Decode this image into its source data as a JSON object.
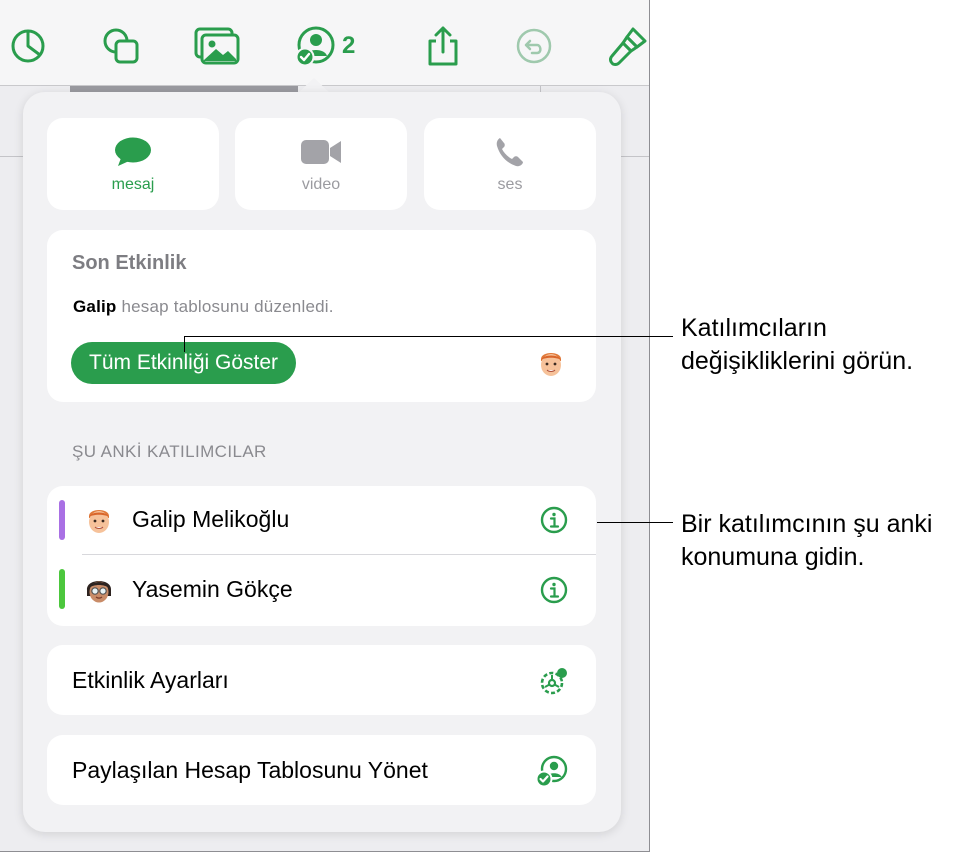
{
  "toolbar": {
    "items": [
      {
        "name": "chart-icon"
      },
      {
        "name": "shapes-icon"
      },
      {
        "name": "media-icon"
      },
      {
        "name": "collaborate-icon",
        "count": "2"
      },
      {
        "name": "share-icon"
      },
      {
        "name": "undo-icon"
      },
      {
        "name": "format-brush-icon"
      }
    ]
  },
  "popover": {
    "share_options": [
      {
        "label": "mesaj",
        "icon": "message-bubble-icon",
        "active": true
      },
      {
        "label": "video",
        "icon": "video-camera-icon",
        "active": false
      },
      {
        "label": "ses",
        "icon": "phone-icon",
        "active": false
      }
    ],
    "recent_activity": {
      "title": "Son Etkinlik",
      "user": "Galip",
      "action": "hesap tablosunu düzenledi.",
      "button_label": "Tüm Etkinliği Göster"
    },
    "participants_header": "ŞU ANKİ KATILIMCILAR",
    "participants": [
      {
        "name": "Galip Melikoğlu",
        "color": "#a970e4",
        "avatar": "memoji-red-hair"
      },
      {
        "name": "Yasemin Gökçe",
        "color": "#4cc73d",
        "avatar": "memoji-dark-hair-glasses"
      }
    ],
    "activity_settings_label": "Etkinlik Ayarları",
    "manage_label": "Paylaşılan Hesap Tablosunu Yönet"
  },
  "callouts": {
    "activity": [
      "Katılımcıların",
      "değişikliklerini görün."
    ],
    "participant": [
      "Bir katılımcının şu anki",
      "konumuna gidin."
    ]
  },
  "colors": {
    "accent": "#2a9d4d",
    "secondary_text": "#8a8a8f",
    "popover_bg": "#f2f2f4"
  }
}
